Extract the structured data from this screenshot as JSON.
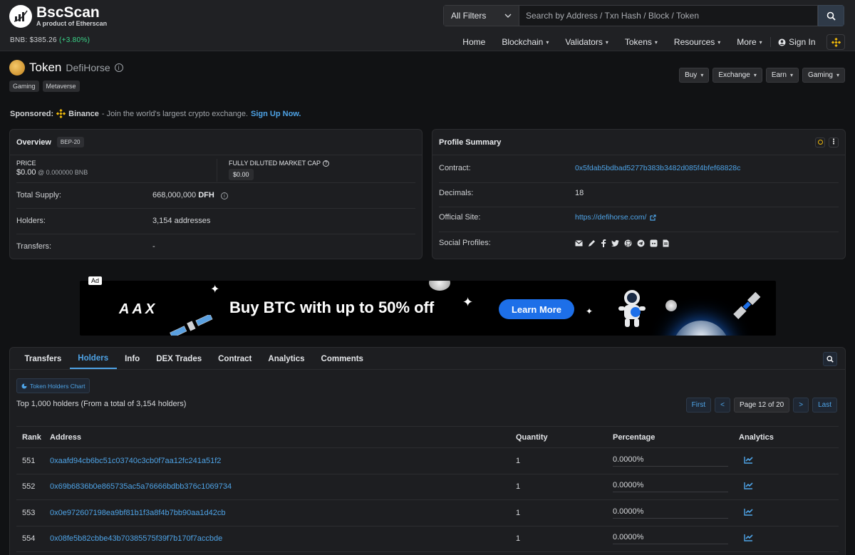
{
  "header": {
    "logo_title": "BscScan",
    "logo_sub": "A product of Etherscan",
    "bnb_label": "BNB: $385.26",
    "bnb_change": "(+3.80%)",
    "filter_label": "All Filters",
    "search_placeholder": "Search by Address / Txn Hash / Block / Token",
    "nav": [
      "Home",
      "Blockchain",
      "Validators",
      "Tokens",
      "Resources",
      "More"
    ],
    "sign_in": "Sign In"
  },
  "token": {
    "title": "Token",
    "name": "DefiHorse",
    "tags": [
      "Gaming",
      "Metaverse"
    ],
    "actions": [
      "Buy",
      "Exchange",
      "Earn",
      "Gaming"
    ]
  },
  "sponsored": {
    "label": "Sponsored:",
    "brand": "Binance",
    "text": "- Join the world's largest crypto exchange.",
    "link": "Sign Up Now."
  },
  "overview": {
    "title": "Overview",
    "badge": "BEP-20",
    "price_label": "PRICE",
    "price_value": "$0.00",
    "price_bnb": "@ 0.000000 BNB",
    "mcap_label": "FULLY DILUTED MARKET CAP",
    "mcap_value": "$0.00",
    "supply_label": "Total Supply:",
    "supply_value": "668,000,000",
    "supply_symbol": "DFH",
    "holders_label": "Holders:",
    "holders_value": "3,154 addresses",
    "transfers_label": "Transfers:",
    "transfers_value": "-"
  },
  "profile": {
    "title": "Profile Summary",
    "contract_label": "Contract:",
    "contract_value": "0x5fdab5bdbad5277b383b3482d085f4bfef68828c",
    "decimals_label": "Decimals:",
    "decimals_value": "18",
    "site_label": "Official Site:",
    "site_value": "https://defihorse.com/",
    "social_label": "Social Profiles:",
    "social_icons": [
      "email-icon",
      "pencil-icon",
      "facebook-icon",
      "twitter-icon",
      "github-icon",
      "telegram-icon",
      "discord-icon",
      "whitepaper-icon"
    ]
  },
  "ad": {
    "label": "Ad",
    "brand": "AAX",
    "headline": "Buy BTC with up to 50% off",
    "cta": "Learn More"
  },
  "tabs": [
    "Transfers",
    "Holders",
    "Info",
    "DEX Trades",
    "Contract",
    "Analytics",
    "Comments"
  ],
  "holders": {
    "chart_button": "Token Holders Chart",
    "summary": "Top 1,000 holders (From a total of 3,154 holders)",
    "pager": {
      "first": "First",
      "prev": "<",
      "page": "Page 12 of 20",
      "next": ">",
      "last": "Last"
    },
    "columns": [
      "Rank",
      "Address",
      "Quantity",
      "Percentage",
      "Analytics"
    ],
    "rows": [
      {
        "rank": "551",
        "address": "0xaafd94cb6bc51c03740c3cb0f7aa12fc241a51f2",
        "quantity": "1",
        "percentage": "0.0000%"
      },
      {
        "rank": "552",
        "address": "0x69b6836b0e865735ac5a76666bdbb376c1069734",
        "quantity": "1",
        "percentage": "0.0000%"
      },
      {
        "rank": "553",
        "address": "0x0e972607198ea9bf81b1f3a8f4b7bb90aa1d42cb",
        "quantity": "1",
        "percentage": "0.0000%"
      },
      {
        "rank": "554",
        "address": "0x08fe5b82cbbe43b70385575f39f7b170f7accbde",
        "quantity": "1",
        "percentage": "0.0000%"
      }
    ]
  },
  "colors": {
    "accent": "#4ea3e6",
    "positive": "#3bd68a",
    "binance": "#f0b90b",
    "ad_cta": "#1d6fe8"
  }
}
